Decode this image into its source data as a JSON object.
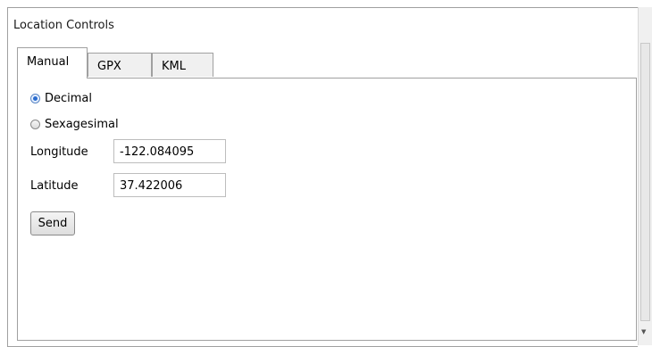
{
  "panel": {
    "title": "Location Controls"
  },
  "tabs": [
    {
      "label": "Manual",
      "active": true
    },
    {
      "label": "GPX",
      "active": false
    },
    {
      "label": "KML",
      "active": false
    }
  ],
  "manual": {
    "format_options": [
      {
        "label": "Decimal",
        "selected": true
      },
      {
        "label": "Sexagesimal",
        "selected": false
      }
    ],
    "longitude": {
      "label": "Longitude",
      "value": "-122.084095"
    },
    "latitude": {
      "label": "Latitude",
      "value": "37.422006"
    },
    "send_label": "Send"
  },
  "scrollbar": {
    "arrow_icon": "scroll-down-arrow",
    "arrow_glyph": "▼"
  }
}
